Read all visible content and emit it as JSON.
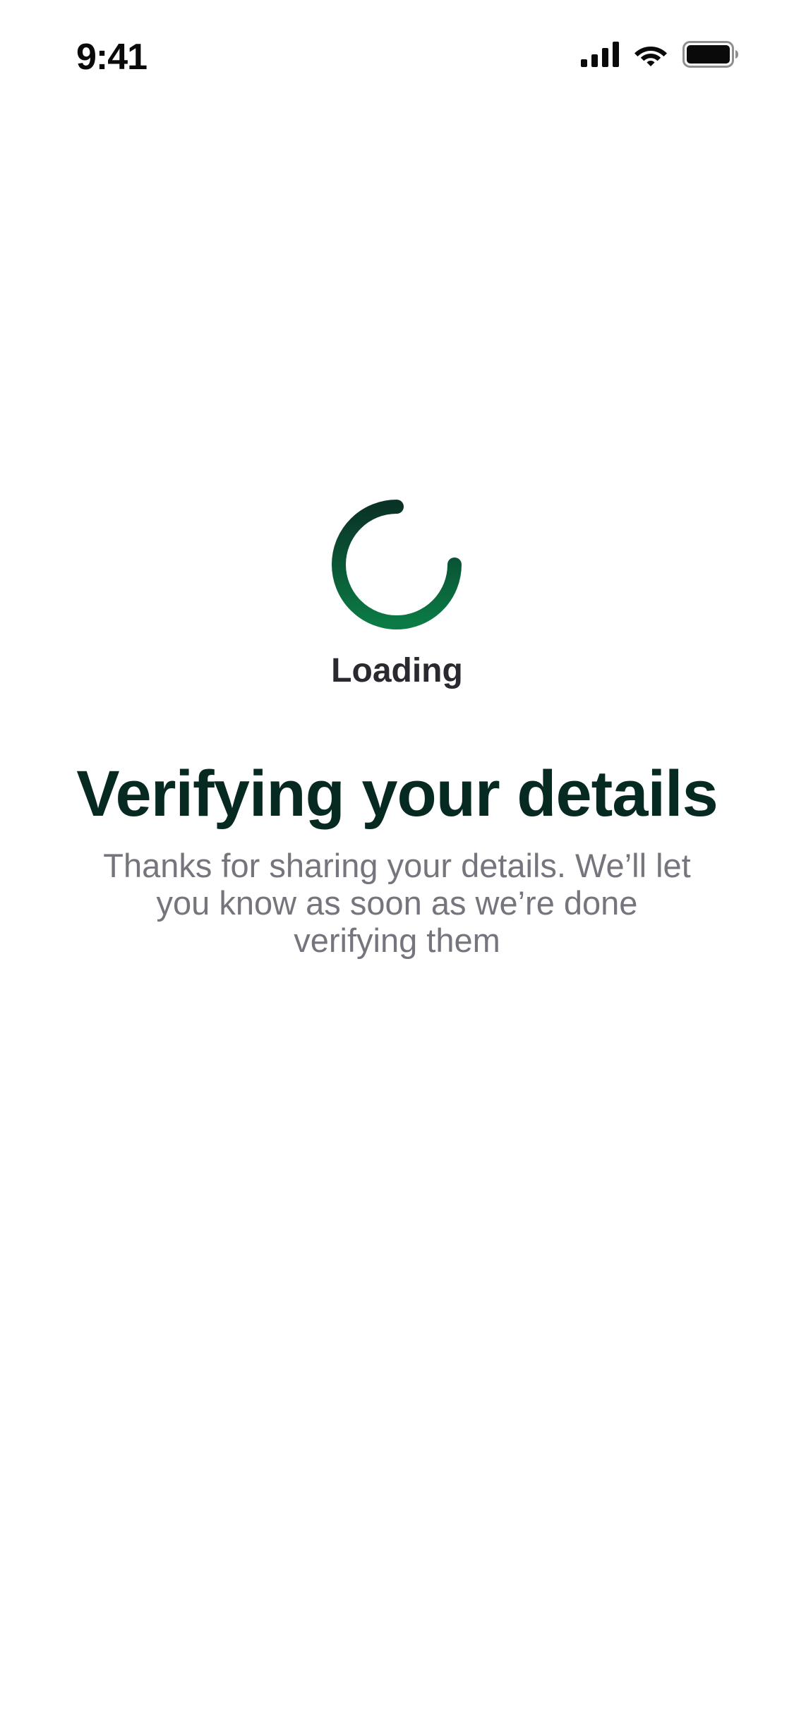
{
  "status_bar": {
    "time": "9:41",
    "icons": [
      "cellular-signal-icon",
      "wifi-icon",
      "battery-icon"
    ]
  },
  "loader": {
    "icon": "loading-spinner-icon",
    "label": "Loading",
    "colors": {
      "start": "#0a3327",
      "end": "#0b7a45"
    }
  },
  "content": {
    "title": "Verifying your details",
    "subtitle": "Thanks for sharing your details. We’ll let you know as soon as we’re done verifying them"
  },
  "colors": {
    "background": "#ffffff",
    "title": "#062a22",
    "subtitle": "#77747d",
    "label": "#2b2930"
  }
}
